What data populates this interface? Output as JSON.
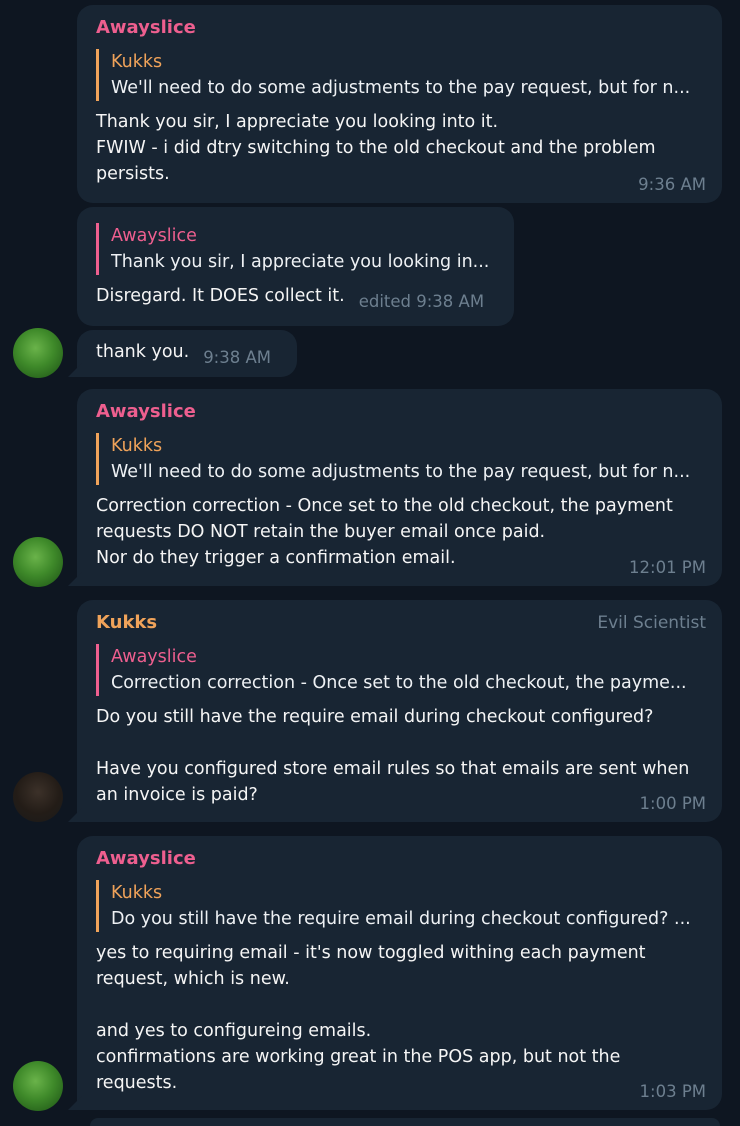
{
  "messages": [
    {
      "sender": "Awayslice",
      "reply": {
        "name": "Kukks",
        "text": "We'll need to do some adjustments to the pay request, but for n..."
      },
      "text": "Thank you sir, I appreciate you looking into it.\nFWIW - i did dtry switching to the old checkout and the problem persists.",
      "time": "9:36 AM"
    },
    {
      "reply": {
        "name": "Awayslice",
        "text": "Thank you sir, I appreciate you looking in..."
      },
      "text": "Disregard. It DOES collect it.",
      "time": "edited 9:38 AM"
    },
    {
      "text": "thank you.",
      "time": "9:38 AM"
    },
    {
      "sender": "Awayslice",
      "reply": {
        "name": "Kukks",
        "text": "We'll need to do some adjustments to the pay request, but for n..."
      },
      "text": "Correction correction - Once set to the old checkout, the payment requests DO NOT retain the buyer email once paid.\nNor do they trigger a confirmation email.",
      "time": "12:01 PM"
    },
    {
      "sender": "Kukks",
      "role": "Evil Scientist",
      "reply": {
        "name": "Awayslice",
        "text": "Correction correction - Once set to the old checkout, the payme..."
      },
      "text": "Do you still have the require email during checkout configured?\n\nHave you configured store email rules so that emails are sent when an invoice is paid?",
      "time": "1:00 PM"
    },
    {
      "sender": "Awayslice",
      "reply": {
        "name": "Kukks",
        "text": "Do you still have the require email during checkout configured? ..."
      },
      "text": "yes to requiring email - it's now toggled withing each payment request, which is new.\n\nand yes to configureing emails.\nconfirmations are working great in the POS app, but not the requests.",
      "time": "1:03 PM"
    }
  ],
  "colors": {
    "background": "#0e1621",
    "bubble": "#182533",
    "awayslice": "#ee5f8f",
    "kukks": "#f0a35a",
    "meta": "#6d7f8f"
  }
}
